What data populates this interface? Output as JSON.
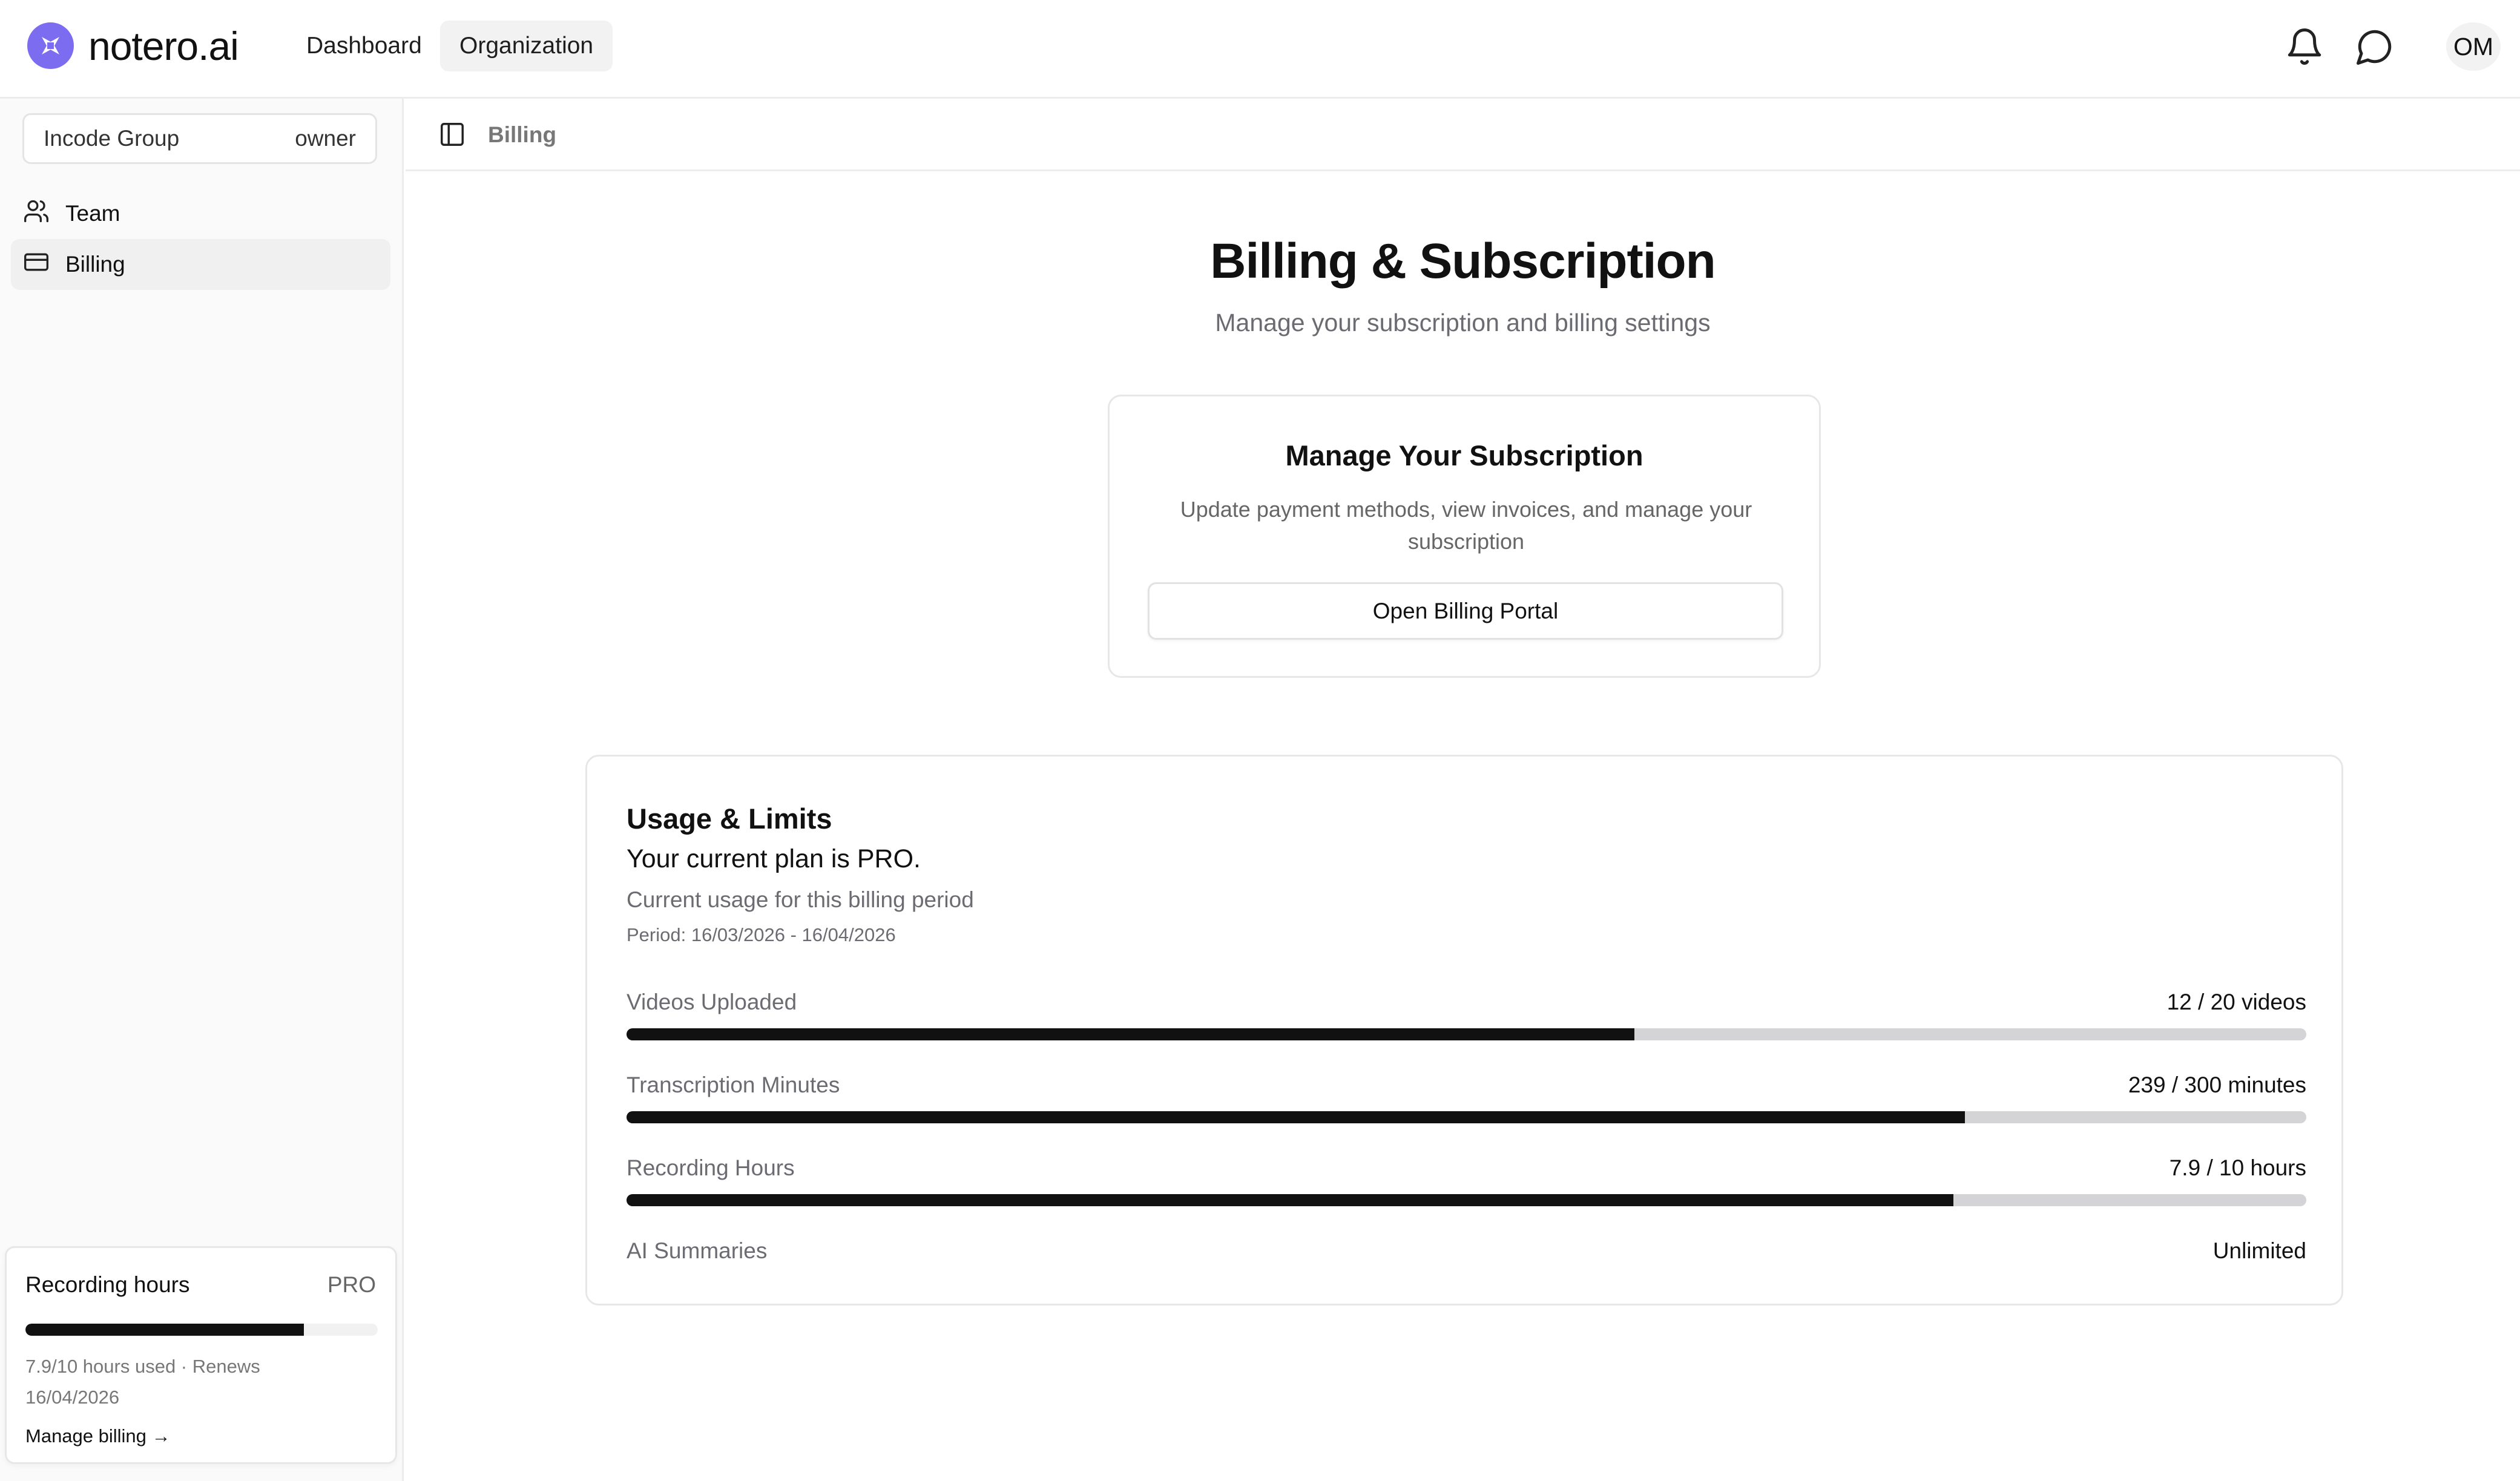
{
  "brand": {
    "name": "notero.ai",
    "accent": "#7c6cf0"
  },
  "topnav": {
    "items": [
      {
        "label": "Dashboard"
      },
      {
        "label": "Organization"
      }
    ],
    "avatar_initials": "OM"
  },
  "sidebar": {
    "org": {
      "name": "Incode Group",
      "role": "owner"
    },
    "items": [
      {
        "label": "Team",
        "icon": "users-icon"
      },
      {
        "label": "Billing",
        "icon": "credit-card-icon"
      }
    ],
    "usage_card": {
      "title": "Recording hours",
      "badge": "PRO",
      "progress_fraction": 0.79,
      "used_text": "7.9/10 hours used · Renews 16/04/2026",
      "link": "Manage billing →"
    }
  },
  "breadcrumb": {
    "current": "Billing"
  },
  "page": {
    "title": "Billing & Subscription",
    "subtitle": "Manage your subscription and billing settings"
  },
  "subscription_card": {
    "title": "Manage Your Subscription",
    "description": "Update payment methods, view invoices, and manage your subscription",
    "button_label": "Open Billing Portal"
  },
  "usage": {
    "title": "Usage & Limits",
    "plan_text": "Your current plan is PRO.",
    "period_desc": "Current usage for this billing period",
    "period": "Period: 16/03/2026 - 16/04/2026",
    "metrics": [
      {
        "label": "Videos Uploaded",
        "value": "12 / 20 videos",
        "fraction": 0.6
      },
      {
        "label": "Transcription Minutes",
        "value": "239 / 300 minutes",
        "fraction": 0.7967
      },
      {
        "label": "Recording Hours",
        "value": "7.9 / 10 hours",
        "fraction": 0.79
      },
      {
        "label": "AI Summaries",
        "value": "Unlimited"
      }
    ]
  }
}
